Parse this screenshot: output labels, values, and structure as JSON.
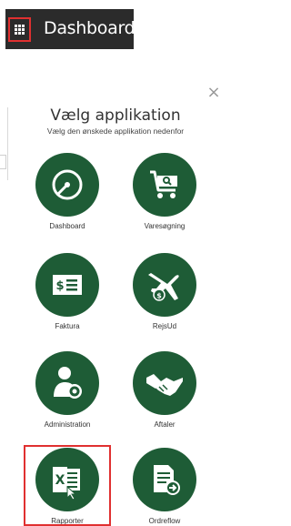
{
  "header": {
    "title": "Dashboard"
  },
  "modal": {
    "close_symbol": "×",
    "title": "Vælg applikation",
    "subtitle": "Vælg den ønskede applikation nedenfor"
  },
  "apps": [
    {
      "label": "Dashboard",
      "icon": "gauge-icon"
    },
    {
      "label": "Varesøgning",
      "icon": "shopping-cart-search-icon"
    },
    {
      "label": "Faktura",
      "icon": "invoice-icon"
    },
    {
      "label": "RejsUd",
      "icon": "plane-money-icon"
    },
    {
      "label": "Administration",
      "icon": "user-gear-icon"
    },
    {
      "label": "Aftaler",
      "icon": "handshake-icon"
    },
    {
      "label": "Rapporter",
      "icon": "excel-icon"
    },
    {
      "label": "Ordreflow",
      "icon": "document-arrow-icon"
    }
  ],
  "colors": {
    "topbar_bg": "#2b2b2b",
    "app_green": "#1e5c36",
    "highlight_red": "#e03030"
  }
}
